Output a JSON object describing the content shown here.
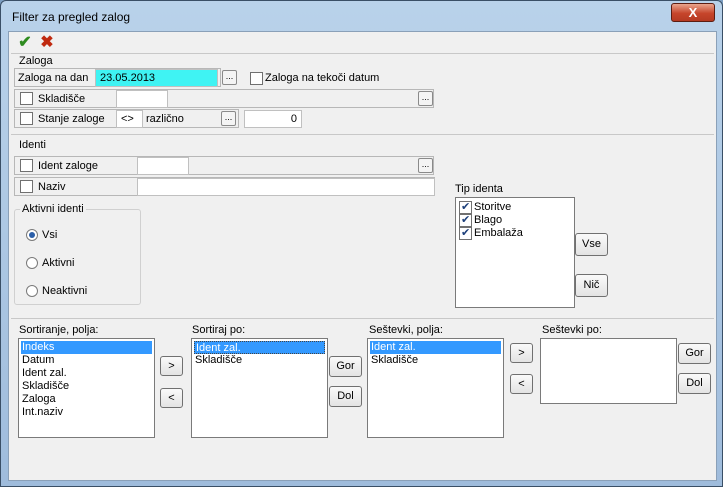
{
  "window": {
    "title": "Filter za pregled zalog",
    "close_label": "X"
  },
  "toolbar": {
    "ok_icon": "checkmark-icon",
    "cancel_icon": "cross-icon"
  },
  "zaloga": {
    "section_label": "Zaloga",
    "date_label": "Zaloga na dan",
    "date_value": "23.05.2013",
    "current_date_label": "Zaloga na tekoči datum",
    "skladisce_label": "Skladišče",
    "skladisce_value": "",
    "stanje_label": "Stanje zaloge",
    "operator_symbol": "<>",
    "operator_text": "različno",
    "stanje_value": "0"
  },
  "identi": {
    "section_label": "Identi",
    "ident_label": "Ident zaloge",
    "ident_value": "",
    "naziv_label": "Naziv",
    "naziv_value": ""
  },
  "aktivni": {
    "title": "Aktivni identi",
    "options": [
      "Vsi",
      "Aktivni",
      "Neaktivni"
    ],
    "selected": "Vsi"
  },
  "tip_identa": {
    "title": "Tip identa",
    "items": [
      {
        "label": "Storitve",
        "checked": true
      },
      {
        "label": "Blago",
        "checked": true
      },
      {
        "label": "Embalaža",
        "checked": true
      }
    ],
    "vse_label": "Vse",
    "nic_label": "Nič"
  },
  "sortiranje": {
    "title": "Sortiranje, polja:",
    "items": [
      "Indeks",
      "Datum",
      "Ident zal.",
      "Skladišče",
      "Zaloga",
      "Int.naziv"
    ],
    "selected": "Indeks"
  },
  "sortiraj_po": {
    "title": "Sortiraj po:",
    "items": [
      "Ident zal.",
      "Skladišče"
    ],
    "selected": "Ident zal."
  },
  "sestevki": {
    "title": "Seštevki, polja:",
    "items": [
      "Ident zal.",
      "Skladišče"
    ],
    "selected": "Ident zal."
  },
  "sestevki_po": {
    "title": "Seštevki po:",
    "items": []
  },
  "buttons": {
    "move_right": ">",
    "move_left": "<",
    "gor": "Gor",
    "dol": "Dol",
    "ellipsis": "..."
  }
}
